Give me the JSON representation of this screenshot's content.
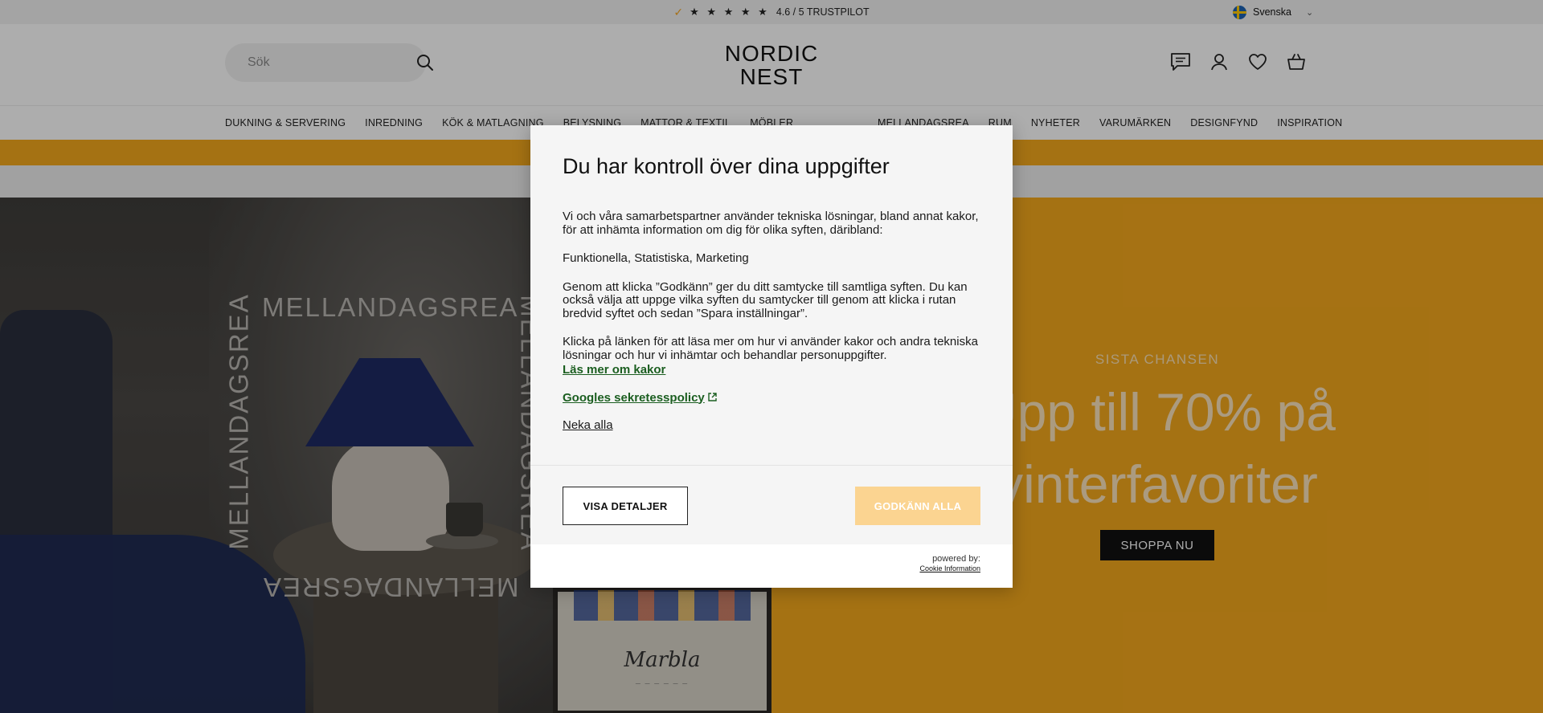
{
  "topbar": {
    "trust_text": "4.6 / 5 TRUSTPILOT",
    "stars": "★ ★ ★ ★ ★",
    "check_icon": "check-icon",
    "language": "Svenska"
  },
  "header": {
    "search_placeholder": "Sök",
    "logo_line1": "NORDIC",
    "logo_line2": "NEST",
    "icons": [
      "chat-icon",
      "account-icon",
      "heart-icon",
      "cart-icon"
    ]
  },
  "nav": {
    "left": [
      "DUKNING & SERVERING",
      "INREDNING",
      "KÖK & MATLAGNING",
      "BELYSNING",
      "MATTOR & TEXTIL",
      "MÖBLER"
    ],
    "right": [
      "MELLANDAGSREA",
      "RUM",
      "NYHETER",
      "VARUMÄRKEN",
      "DESIGNFYND",
      "INSPIRATION"
    ]
  },
  "hero": {
    "left_repeat_text": "MELLANDAGSREA",
    "poster_signature": "Marbla",
    "kicker": "SISTA CHANSEN",
    "headline_line1": "Upp till 70% på",
    "headline_line2": "vinterfavoriter",
    "cta": "SHOPPA NU"
  },
  "consent": {
    "title": "Du har kontroll över dina uppgifter",
    "p1": "Vi och våra samarbetspartner använder tekniska lösningar, bland annat kakor, för att inhämta information om dig för olika syften, däribland:",
    "p2": "Funktionella, Statistiska, Marketing",
    "p3": "Genom att klicka ”Godkänn” ger du ditt samtycke till samtliga syften. Du kan också välja att uppge vilka syften du samtycker till genom att klicka i rutan bredvid syftet och sedan ”Spara inställningar”.",
    "p4": "Klicka på länken för att läsa mer om hur vi använder kakor och andra tekniska lösningar och hur vi inhämtar och behandlar personuppgifter.",
    "link_cookies": "Läs mer om kakor",
    "link_google": "Googles sekretesspolicy",
    "link_deny": "Neka alla",
    "btn_details": "VISA DETALJER",
    "btn_accept": "GODKÄNN ALLA",
    "powered_by": "powered by:",
    "powered_link": "Cookie Information"
  },
  "colors": {
    "accent_orange": "#f4a81d",
    "accept_button": "#fbd491",
    "link_green": "#1b5e20"
  }
}
